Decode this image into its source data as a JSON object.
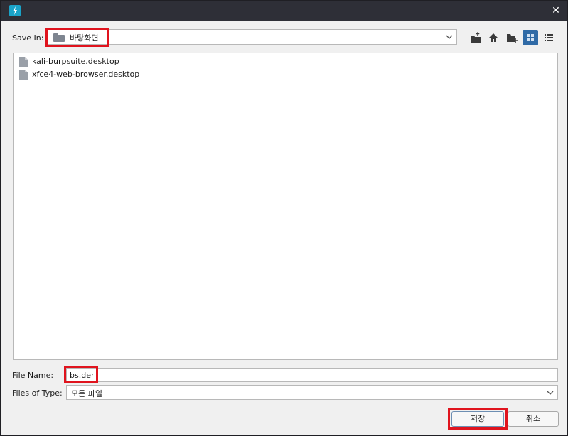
{
  "window": {
    "close_glyph": "✕"
  },
  "save_in": {
    "label": "Save In:",
    "value": "바탕화면"
  },
  "files": [
    {
      "name": "kali-burpsuite.desktop"
    },
    {
      "name": "xfce4-web-browser.desktop"
    }
  ],
  "file_name": {
    "label": "File Name:",
    "value": "bs.der"
  },
  "file_type": {
    "label": "Files of Type:",
    "value": "모든 파일"
  },
  "buttons": {
    "save": "저장",
    "cancel": "취소"
  },
  "colors": {
    "titlebar": "#2e2f37",
    "app_icon": "#1aa3c8",
    "highlight": "#e0141e",
    "active_view": "#2f6aa6"
  },
  "icons": [
    "app-icon",
    "close-icon",
    "folder-icon",
    "chevron-down-icon",
    "up-folder-icon",
    "home-icon",
    "new-folder-icon",
    "grid-view-icon",
    "list-view-icon",
    "document-icon"
  ]
}
